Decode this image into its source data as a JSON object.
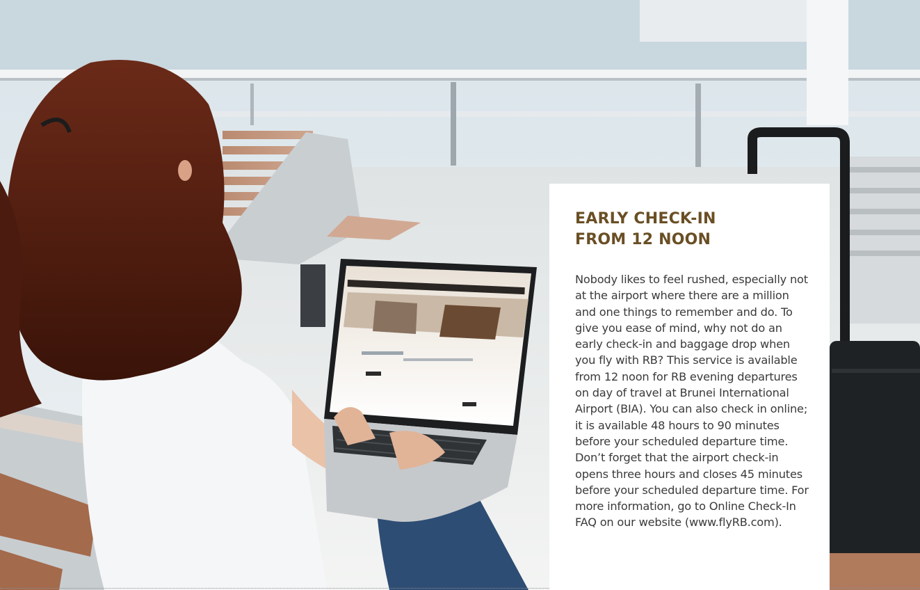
{
  "panel": {
    "title_line1": "EARLY CHECK-IN",
    "title_line2": "FROM 12 NOON",
    "body": "Nobody likes to feel rushed, especially not at the airport where there are a million and one things to remember and do. To give you ease of mind, why not do an early check-in and baggage drop when you fly with RB? This service is available from 12 noon for RB evening departures on day of travel at Brunei International Airport (BIA). You can also check in online; it is available 48 hours to 90 minutes before your scheduled departure time. Don’t forget that the airport check-in opens three hours and closes 45 minutes before your scheduled departure time. For more information, go to Online Check-In FAQ on our website (www.flyRB.com)."
  },
  "colors": {
    "title": "#6a4f25",
    "body_text": "#3a3a3a",
    "card_background": "#ffffff"
  }
}
